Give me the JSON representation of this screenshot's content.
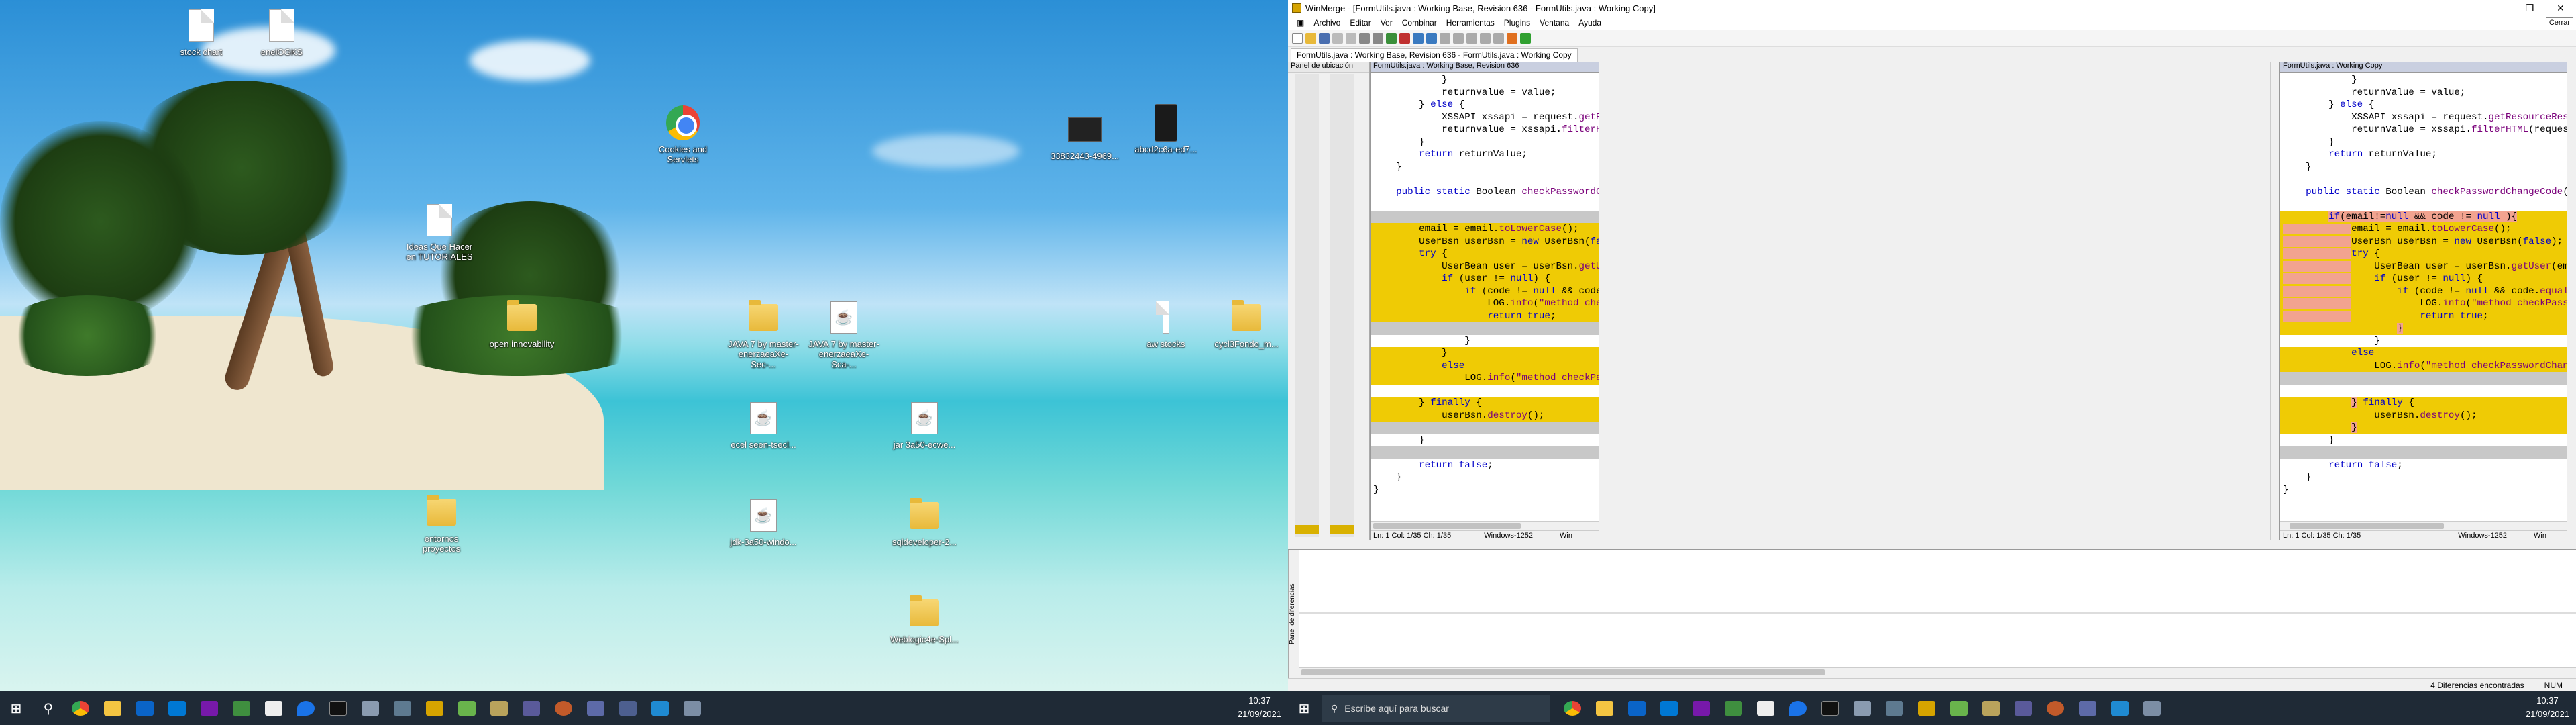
{
  "desktop": {
    "icons": [
      {
        "name": "desktop-icon-stock-chart",
        "type": "doc",
        "label": "stock chart"
      },
      {
        "name": "desktop-icon-enelogks",
        "type": "doc",
        "label": "enelOGKS"
      },
      {
        "name": "desktop-icon-cookies-servlets",
        "type": "chrome",
        "label": "Cookies and Servlets"
      },
      {
        "name": "desktop-icon-dark-file-1",
        "type": "dark",
        "label": "33832443-4969..."
      },
      {
        "name": "desktop-icon-dark-file-2",
        "type": "dark2",
        "label": "abcd2c6a-ed7..."
      },
      {
        "name": "desktop-icon-tutoriales-doc",
        "type": "doc",
        "label": "Ideas Que Hacer en TUTORIALES"
      },
      {
        "name": "desktop-icon-folder-openinnovability",
        "type": "folder",
        "label": "open innovability"
      },
      {
        "name": "desktop-icon-folder-java-master",
        "type": "folder",
        "label": "JAVA 7 by master-enerzaeaXe-Sec-..."
      },
      {
        "name": "desktop-icon-java-1",
        "type": "java",
        "label": "JAVA 7 by master-enerzaeaXe-Sca-..."
      },
      {
        "name": "desktop-icon-doc-aw-stocks",
        "type": "doc",
        "label": "aw stocks"
      },
      {
        "name": "desktop-icon-folder-cycl",
        "type": "folder",
        "label": "cycl3Fondo_m..."
      },
      {
        "name": "desktop-icon-java-2",
        "type": "java",
        "label": "ecel seen-tsecl..."
      },
      {
        "name": "desktop-icon-java-3",
        "type": "java",
        "label": "jar 3a50-ecwe..."
      },
      {
        "name": "desktop-icon-folder-entornos",
        "type": "folder",
        "label": "entornos proyectos"
      },
      {
        "name": "desktop-icon-java-4",
        "type": "java",
        "label": "jdk-3a50-windo..."
      },
      {
        "name": "desktop-icon-folder-sqldeveloper",
        "type": "folder",
        "label": "sqldeveloper-2..."
      },
      {
        "name": "desktop-icon-folder-weblogic",
        "type": "folder",
        "label": "Weblogic4e-Spl..."
      }
    ],
    "taskbar_icons": [
      "start-icon",
      "search-icon",
      "chrome-icon",
      "file-explorer-icon",
      "outlook-icon",
      "mail-icon",
      "onenote-icon",
      "teams-icon",
      "terminal-icon",
      "maps-icon",
      "cmd-icon",
      "app-icon",
      "app-icon-2",
      "winmerge-icon",
      "notepad-icon",
      "app-icon-3",
      "app-icon-4",
      "app-icon-5",
      "vscode-icon",
      "app-icon-6"
    ],
    "clock_time": "10:37",
    "clock_date": "21/09/2021"
  },
  "winmerge": {
    "title": "WinMerge - [FormUtils.java : Working Base, Revision 636 - FormUtils.java : Working Copy]",
    "menu": [
      "Archivo",
      "Editar",
      "Ver",
      "Combinar",
      "Herramientas",
      "Plugins",
      "Ventana",
      "Ayuda"
    ],
    "tooltip": "Cerrar",
    "tab_label": "FormUtils.java : Working Base, Revision 636 - FormUtils.java : Working Copy",
    "location_pane_label": "Panel de ubicación",
    "left_header": "FormUtils.java : Working Base, Revision 636",
    "right_header": "FormUtils.java : Working Copy",
    "left_status": {
      "pos": "Ln: 1  Col: 1/35  Ch: 1/35",
      "enc": "Windows-1252",
      "eol": "Win"
    },
    "right_status": {
      "pos": "Ln: 1  Col: 1/35  Ch: 1/35",
      "enc": "Windows-1252",
      "eol": "Win"
    },
    "diff_pane_label": "Panel de diferencias",
    "status_diffs": "4 Diferencias encontradas",
    "status_num": "NUM",
    "colors": {
      "diff": "#efcb05",
      "blank": "#c8c8c8",
      "word_diff": "#f2a38f"
    }
  },
  "taskbar2": {
    "search_placeholder": "Escribe aquí para buscar",
    "clock_time": "10:37",
    "clock_date": "21/09/2021"
  }
}
